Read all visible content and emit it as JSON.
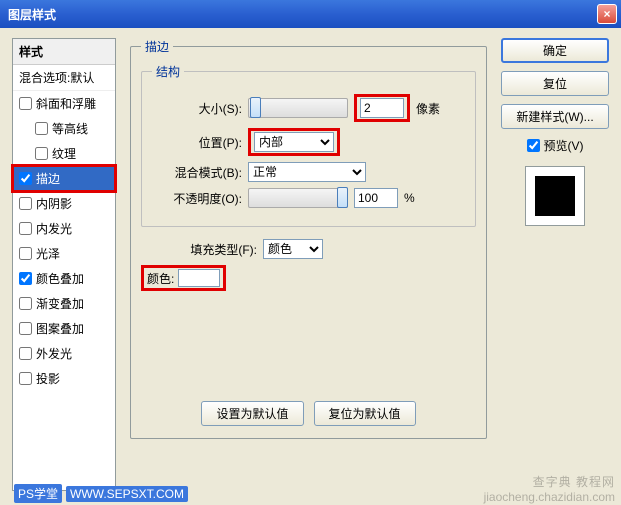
{
  "window": {
    "title": "图层样式",
    "close": "×"
  },
  "sidebar": {
    "header": "样式",
    "blend_defaults": "混合选项:默认",
    "items": [
      {
        "label": "斜面和浮雕",
        "checked": false,
        "indent": false,
        "selected": false
      },
      {
        "label": "等高线",
        "checked": false,
        "indent": true,
        "selected": false
      },
      {
        "label": "纹理",
        "checked": false,
        "indent": true,
        "selected": false
      },
      {
        "label": "描边",
        "checked": true,
        "indent": false,
        "selected": true
      },
      {
        "label": "内阴影",
        "checked": false,
        "indent": false,
        "selected": false
      },
      {
        "label": "内发光",
        "checked": false,
        "indent": false,
        "selected": false
      },
      {
        "label": "光泽",
        "checked": false,
        "indent": false,
        "selected": false
      },
      {
        "label": "颜色叠加",
        "checked": true,
        "indent": false,
        "selected": false
      },
      {
        "label": "渐变叠加",
        "checked": false,
        "indent": false,
        "selected": false
      },
      {
        "label": "图案叠加",
        "checked": false,
        "indent": false,
        "selected": false
      },
      {
        "label": "外发光",
        "checked": false,
        "indent": false,
        "selected": false
      },
      {
        "label": "投影",
        "checked": false,
        "indent": false,
        "selected": false
      }
    ]
  },
  "panel": {
    "title": "描边",
    "structure": {
      "legend": "结构",
      "size_label": "大小(S):",
      "size_value": "2",
      "size_unit": "像素",
      "position_label": "位置(P):",
      "position_value": "内部",
      "blendmode_label": "混合模式(B):",
      "blendmode_value": "正常",
      "opacity_label": "不透明度(O):",
      "opacity_value": "100",
      "opacity_unit": "%"
    },
    "fill": {
      "filltype_label": "填充类型(F):",
      "filltype_value": "颜色",
      "color_label": "颜色:",
      "color_value": "#ffffff"
    },
    "buttons": {
      "set_default": "设置为默认值",
      "reset_default": "复位为默认值"
    }
  },
  "right": {
    "ok": "确定",
    "reset": "复位",
    "new_style": "新建样式(W)...",
    "preview_label": "预览(V)",
    "preview_checked": true
  },
  "watermark": {
    "brand": "PS学堂",
    "url": "WWW.SEPSXT.COM"
  },
  "corner": {
    "line1": "查字典 教程网",
    "line2": "jiaocheng.chazidian.com"
  }
}
